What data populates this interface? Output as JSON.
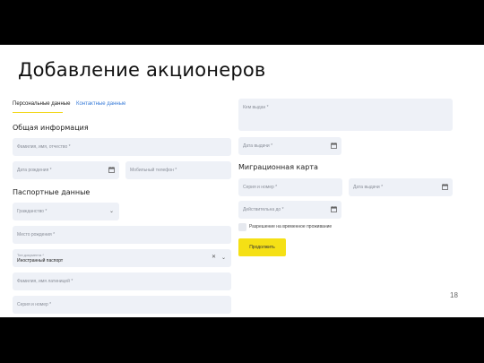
{
  "title": "Добавление акционеров",
  "page_number": "18",
  "tabs": [
    {
      "label": "Персональные данные"
    },
    {
      "label": "Контактные данные"
    }
  ],
  "sections": {
    "general": "Общая информация",
    "passport": "Паспортные данные",
    "migration": "Миграционная карта"
  },
  "fields": {
    "fio": "Фамилия, имя, отчество *",
    "birth_date": "Дата рождения *",
    "mobile_phone": "Мобильный телефон *",
    "citizenship": "Гражданство *",
    "birth_place": "Место рождения *",
    "doc_type_label": "Тип документа *",
    "doc_type_value": "Иностранный паспорт",
    "latin_name": "Фамилия, имя латиницей *",
    "series_number": "Серия и номер *",
    "issued_by": "Кем выдан *",
    "issue_date": "Дата выдачи *",
    "mig_series_number": "Серия и номер *",
    "mig_issue_date": "Дата выдачи *",
    "valid_until": "Действительна до *"
  },
  "checkbox_label": "Разрешение на временное проживание",
  "submit_label": "Продолжить",
  "colors": {
    "accent": "#f5e015",
    "field_bg": "#eef1f7",
    "link": "#3b7dd8"
  },
  "icons": {
    "calendar": "calendar-icon",
    "chevron": "chevron-down-icon",
    "clear": "close-icon"
  }
}
